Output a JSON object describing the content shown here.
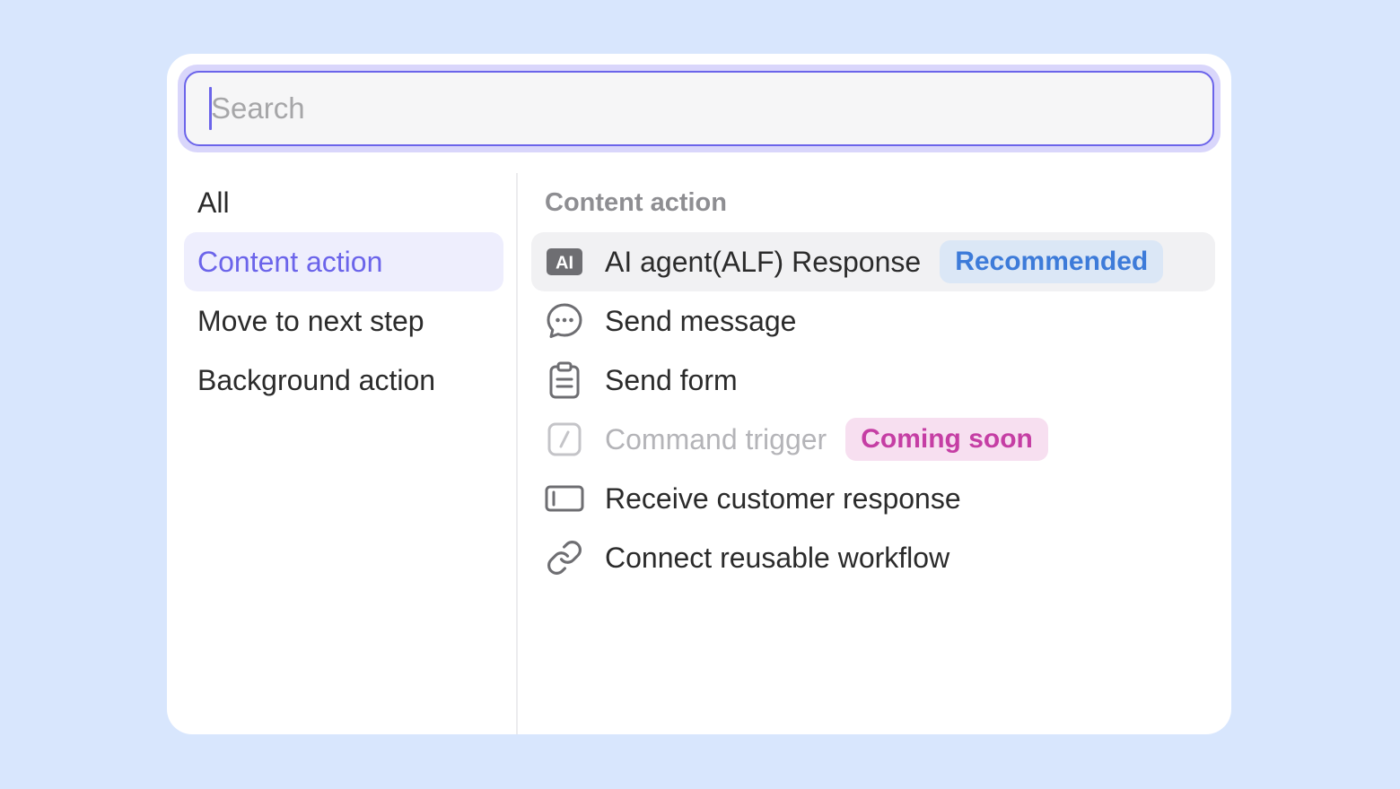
{
  "search": {
    "placeholder": "Search",
    "value": ""
  },
  "categories": [
    {
      "label": "All",
      "active": false
    },
    {
      "label": "Content action",
      "active": true
    },
    {
      "label": "Move to next step",
      "active": false
    },
    {
      "label": "Background action",
      "active": false
    }
  ],
  "section": {
    "title": "Content action"
  },
  "items": [
    {
      "label": "AI agent(ALF) Response",
      "icon": "ai-badge-icon",
      "badge": "Recommended"
    },
    {
      "label": "Send message",
      "icon": "chat-bubble-icon"
    },
    {
      "label": "Send form",
      "icon": "clipboard-icon"
    },
    {
      "label": "Command trigger",
      "icon": "slash-command-icon",
      "badge": "Coming soon",
      "disabled": true
    },
    {
      "label": "Receive customer response",
      "icon": "input-field-icon"
    },
    {
      "label": "Connect reusable workflow",
      "icon": "link-icon"
    }
  ],
  "colors": {
    "accent": "#6b64ea",
    "recommended_badge_text": "#3d7bd9",
    "recommended_badge_bg": "#dbe7f6",
    "coming_soon_badge_text": "#c53ea4",
    "coming_soon_badge_bg": "#f7dff0",
    "background": "#d8e6fd"
  }
}
